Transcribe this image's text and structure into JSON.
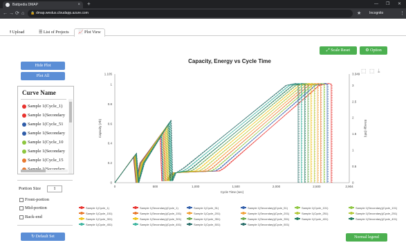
{
  "browser": {
    "tab_title": "Battpedia DMAP",
    "tab_close": "×",
    "new_tab": "+",
    "url": "dmap.westus.cloudapp.azure.com",
    "incognito": "Incognito",
    "min": "—",
    "max": "❐",
    "close": "✕",
    "back": "←",
    "forward": "→",
    "reload": "⟳",
    "home": "⌂",
    "star": "★",
    "menu": "⋮",
    "lock": "🔒"
  },
  "app_tabs": [
    {
      "label": "Upload",
      "icon": "upload-icon"
    },
    {
      "label": "List of Projects",
      "icon": "list-icon"
    },
    {
      "label": "Plot View",
      "icon": "chart-icon"
    }
  ],
  "sidebar": {
    "hide_plot": "Hide Plot",
    "plot_all": "Plot All",
    "curve_name_header": "Curve Name",
    "curves": [
      {
        "label": "Sample 1(Cycle_1)",
        "color": "#e8322e"
      },
      {
        "label": "Sample 1(Secondary",
        "color": "#e8322e"
      },
      {
        "label": "Sample 1(Cycle_51",
        "color": "#2f5ca8"
      },
      {
        "label": "Sample 1(Secondary",
        "color": "#2f5ca8"
      },
      {
        "label": "Sample 1(Cycle_10",
        "color": "#8dc63f"
      },
      {
        "label": "Sample 1(Secondary",
        "color": "#8dc63f"
      },
      {
        "label": "Sample 1(Cycle_15",
        "color": "#e8782e"
      },
      {
        "label": "Sample 1(Secondary",
        "color": "#e8782e"
      }
    ],
    "portion_size_label": "Portion Size",
    "portion_size_value": "1",
    "front_portion": "Front-portion",
    "mid_portion": "Mid-portion",
    "back_end": "Back-end",
    "default_set": "Default Set"
  },
  "toolbar": {
    "scale_reset": "Scale Reset",
    "option": "Option",
    "normal_legend": "Normal legend"
  },
  "chart_data": {
    "type": "line",
    "title": "Capacity, Energy vs Cycle Time",
    "xlabel": "Cycle Time (sec)",
    "ylabel_left": "Capacity (Ah)",
    "ylabel_right": "Energy (Wh)",
    "xlim": [
      0,
      2904
    ],
    "ylim_left": [
      0,
      1.105
    ],
    "ylim_right": [
      0,
      3.349
    ],
    "x_ticks": [
      "0",
      "500",
      "1,000",
      "1,500",
      "2,000",
      "2,500",
      "2,904"
    ],
    "y_left_ticks": [
      "0",
      "0.2",
      "0.4",
      "0.6",
      "0.8",
      "1",
      "1.105"
    ],
    "y_right_ticks": [
      "0",
      "0.5",
      "1",
      "1.5",
      "2",
      "2.5",
      "3",
      "3.349"
    ],
    "series": [
      {
        "name": "Sample 1(Cycle_1)",
        "color": "#e8322e",
        "dash": false,
        "charge_start": 1300,
        "charge_end": 2650
      },
      {
        "name": "Sample 1(Secondary)(Cycle_1)",
        "color": "#e8322e",
        "dash": true,
        "charge_start": 1290,
        "charge_end": 2660
      },
      {
        "name": "Sample 1(Cycle_51)",
        "color": "#2f5ca8",
        "dash": false,
        "charge_start": 1250,
        "charge_end": 2600
      },
      {
        "name": "Sample 1(Secondary)(Cycle_51)",
        "color": "#2f5ca8",
        "dash": true,
        "charge_start": 1240,
        "charge_end": 2610
      },
      {
        "name": "Sample 1(Cycle_101)",
        "color": "#8dc63f",
        "dash": false,
        "charge_start": 1200,
        "charge_end": 2560
      },
      {
        "name": "Sample 1(Secondary)(Cycle_101)",
        "color": "#8dc63f",
        "dash": true,
        "charge_start": 1190,
        "charge_end": 2570
      },
      {
        "name": "Sample 1(Cycle_151)",
        "color": "#e8782e",
        "dash": false,
        "charge_start": 1150,
        "charge_end": 2520
      },
      {
        "name": "Sample 1(Secondary)(Cycle_151)",
        "color": "#e8782e",
        "dash": true,
        "charge_start": 1140,
        "charge_end": 2530
      },
      {
        "name": "Sample 1(Cycle_201)",
        "color": "#f2a33a",
        "dash": false,
        "charge_start": 1100,
        "charge_end": 2480
      },
      {
        "name": "Sample 1(Secondary)(Cycle_201)",
        "color": "#f2a33a",
        "dash": true,
        "charge_start": 1090,
        "charge_end": 2490
      },
      {
        "name": "Sample 1(Cycle_251)",
        "color": "#b5c93a",
        "dash": false,
        "charge_start": 1050,
        "charge_end": 2440
      },
      {
        "name": "Sample 1(Secondary)(Cycle_251)",
        "color": "#b5c93a",
        "dash": true,
        "charge_start": 1040,
        "charge_end": 2450
      },
      {
        "name": "Sample 1(Cycle_301)",
        "color": "#f0c419",
        "dash": false,
        "charge_start": 1000,
        "charge_end": 2400
      },
      {
        "name": "Sample 1(Secondary)(Cycle_301)",
        "color": "#f0c419",
        "dash": true,
        "charge_start": 990,
        "charge_end": 2410
      },
      {
        "name": "Sample 1(Cycle_351)",
        "color": "#6aa84f",
        "dash": false,
        "charge_start": 950,
        "charge_end": 2360
      },
      {
        "name": "Sample 1(Secondary)(Cycle_351)",
        "color": "#6aa84f",
        "dash": true,
        "charge_start": 940,
        "charge_end": 2370
      },
      {
        "name": "Sample 1(Cycle_401)",
        "color": "#1f7a5c",
        "dash": false,
        "charge_start": 900,
        "charge_end": 2320
      },
      {
        "name": "Sample 1(Secondary)(Cycle_401)",
        "color": "#1f7a5c",
        "dash": true,
        "charge_start": 890,
        "charge_end": 2330
      },
      {
        "name": "Sample 1(Cycle_451)",
        "color": "#3fb5a0",
        "dash": false,
        "charge_start": 850,
        "charge_end": 2280
      },
      {
        "name": "Sample 1(Secondary)(Cycle_451)",
        "color": "#3fb5a0",
        "dash": true,
        "charge_start": 840,
        "charge_end": 2290
      },
      {
        "name": "Sample 1(Cycle_501)",
        "color": "#2a6f6a",
        "dash": false,
        "charge_start": 800,
        "charge_end": 2240
      },
      {
        "name": "Sample 1(Secondary)(Cycle_501)",
        "color": "#2a6f6a",
        "dash": true,
        "charge_start": 790,
        "charge_end": 2250
      }
    ],
    "legend": [
      "Sample 1(Cycle_1)",
      "Sample 1(Secondary)(Cycle_1)",
      "Sample 1(Cycle_51)",
      "Sample 1(Secondary)(Cycle_51)",
      "Sample 1(Cycle_101)",
      "Sample 1(Secondary)(Cycle_101)",
      "Sample 1(Cycle_151)",
      "Sample 1(Secondary)(Cycle_151)",
      "Sample 1(Cycle_201)",
      "Sample 1(Secondary)(Cycle_201)",
      "Sample 1(Cycle_251)",
      "Sample 1(Secondary)(Cycle_251)",
      "Sample 1(Cycle_301)",
      "Sample 1(Secondary)(Cycle_301)",
      "Sample 1(Cycle_351)",
      "Sample 1(Secondary)(Cycle_351)",
      "Sample 1(Cycle_401)",
      "Sample 1(Secondary)(Cycle_401)",
      "Sample 1(Cycle_451)",
      "Sample 1(Secondary)(Cycle_451)",
      "Sample 1(Cycle_501)",
      "Sample 1(Secondary)(Cycle_501)"
    ],
    "legend_placement": "bottom",
    "grid": false
  }
}
